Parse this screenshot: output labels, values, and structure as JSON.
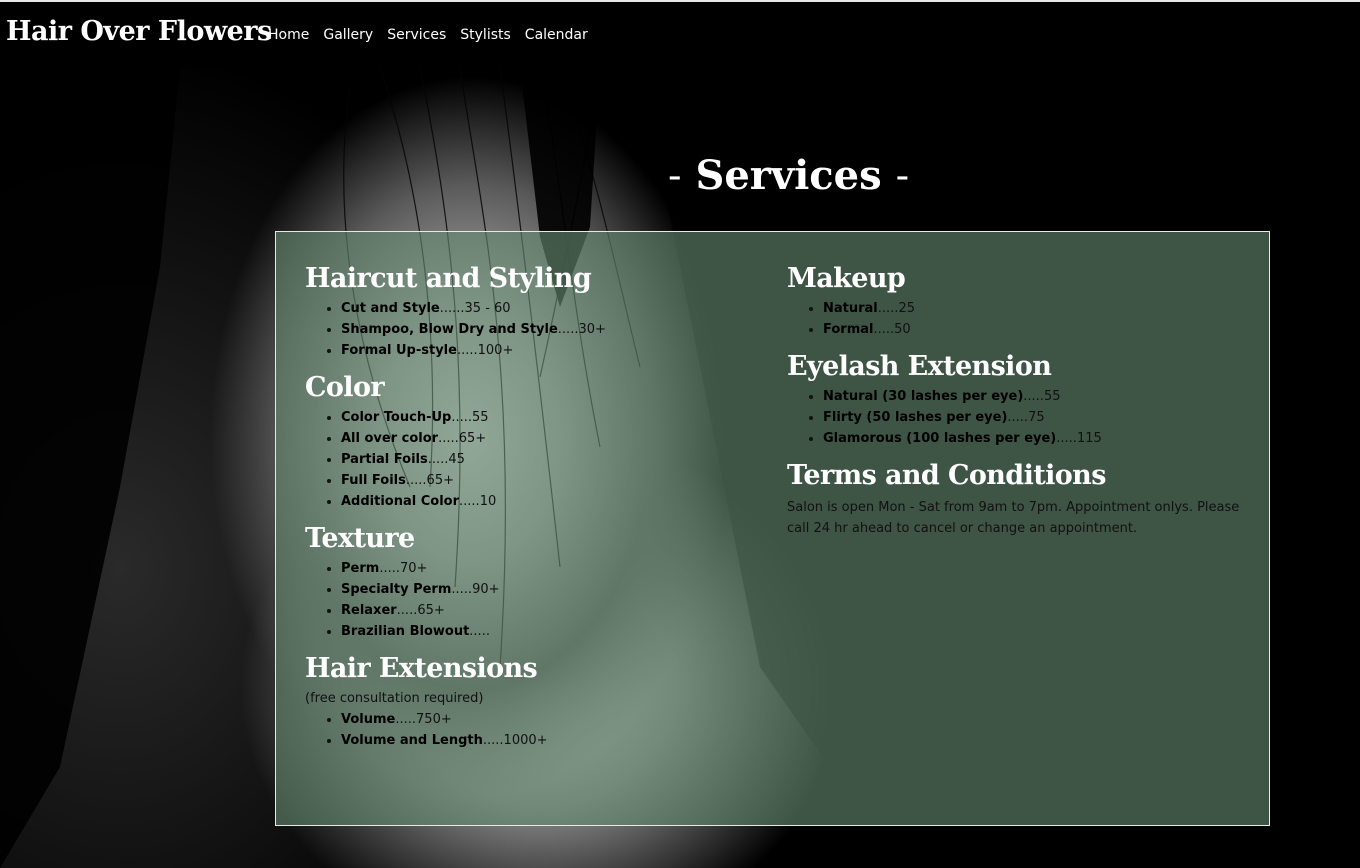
{
  "brand": "Hair Over Flowers",
  "nav": [
    "Home",
    "Gallery",
    "Services",
    "Stylists",
    "Calendar"
  ],
  "page_title": "Services",
  "title_dash": "-",
  "left_column": [
    {
      "heading": "Haircut and Styling",
      "items": [
        {
          "name": "Cut and Style",
          "sep": "......",
          "price": "35 - 60"
        },
        {
          "name": "Shampoo, Blow Dry and Style",
          "sep": ".....",
          "price": "30+"
        },
        {
          "name": "Formal Up-style",
          "sep": ".....",
          "price": "100+"
        }
      ]
    },
    {
      "heading": "Color",
      "items": [
        {
          "name": "Color Touch-Up",
          "sep": ".....",
          "price": "55"
        },
        {
          "name": "All over color",
          "sep": ".....",
          "price": "65+"
        },
        {
          "name": "Partial Foils",
          "sep": ".....",
          "price": "45"
        },
        {
          "name": "Full Foils",
          "sep": ".....",
          "price": "65+"
        },
        {
          "name": "Additional Color",
          "sep": ".....",
          "price": "10"
        }
      ]
    },
    {
      "heading": "Texture",
      "items": [
        {
          "name": "Perm",
          "sep": ".....",
          "price": "70+"
        },
        {
          "name": "Specialty Perm",
          "sep": ".....",
          "price": "90+"
        },
        {
          "name": "Relaxer",
          "sep": ".....",
          "price": "65+"
        },
        {
          "name": "Brazilian Blowout",
          "sep": ".....",
          "price": ""
        }
      ]
    },
    {
      "heading": "Hair Extensions",
      "note": "(free consultation required)",
      "items": [
        {
          "name": "Volume",
          "sep": ".....",
          "price": "750+"
        },
        {
          "name": "Volume and Length",
          "sep": ".....",
          "price": "1000+"
        }
      ]
    }
  ],
  "right_column": [
    {
      "heading": "Makeup",
      "items": [
        {
          "name": "Natural",
          "sep": ".....",
          "price": "25"
        },
        {
          "name": "Formal",
          "sep": ".....",
          "price": "50"
        }
      ]
    },
    {
      "heading": "Eyelash Extension",
      "items": [
        {
          "name": "Natural (30 lashes per eye)",
          "sep": ".....",
          "price": "55"
        },
        {
          "name": "Flirty (50 lashes per eye)",
          "sep": ".....",
          "price": "75"
        },
        {
          "name": "Glamorous (100 lashes per eye)",
          "sep": ".....",
          "price": "115"
        }
      ]
    }
  ],
  "terms": {
    "heading": "Terms and Conditions",
    "text": "Salon is open Mon - Sat from 9am to 7pm. Appointment onlys. Please call 24 hr ahead to cancel or change an appointment."
  }
}
